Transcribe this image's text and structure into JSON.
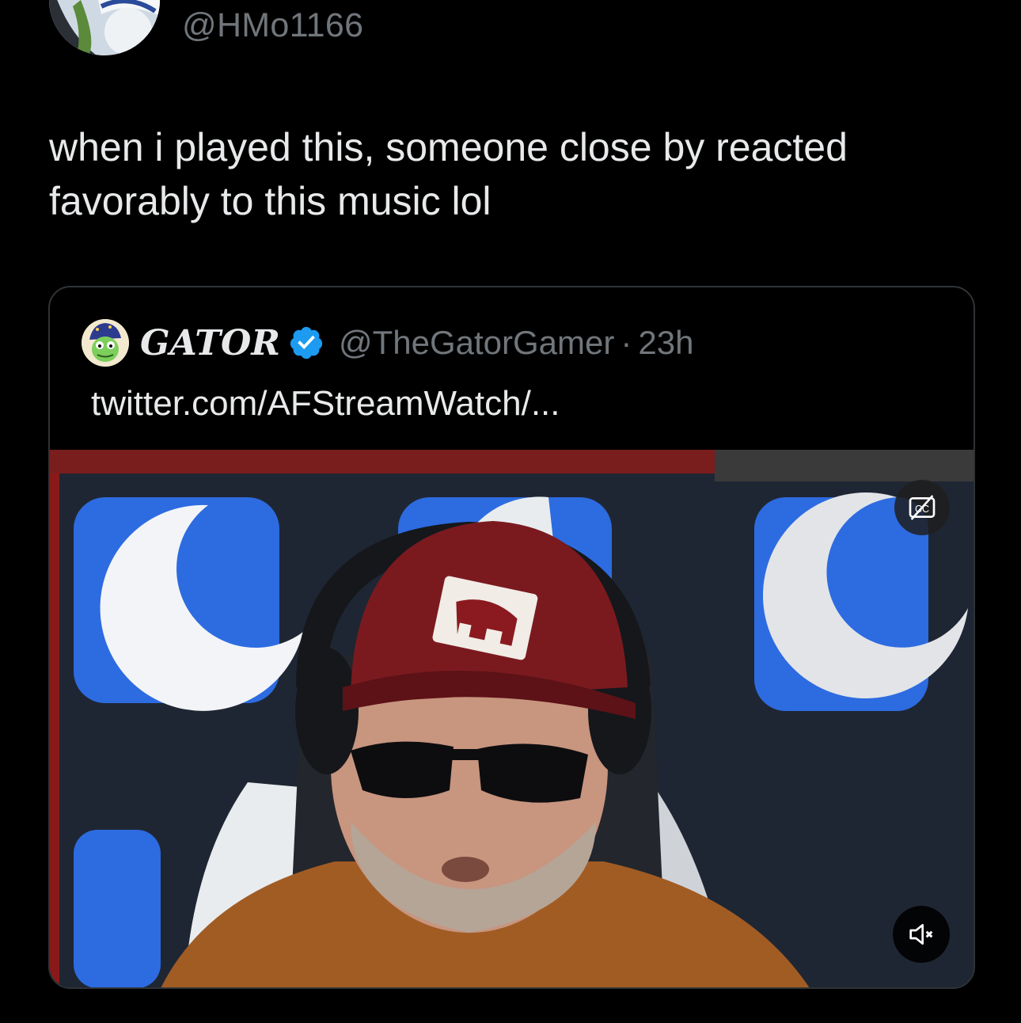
{
  "author": {
    "handle": "@HMo1166",
    "avatar_icon": "michelin-man-avatar"
  },
  "tweet": {
    "lines": [
      "when i played this, someone close by reacted",
      "favorably to this music lol"
    ]
  },
  "quoted_tweet": {
    "display_name": "GATOR",
    "handle": "@TheGatorGamer",
    "separator": "·",
    "time": "23h",
    "link_text": "twitter.com/AFStreamWatch/...",
    "verified": true,
    "avatar_icon": "gator-avatar",
    "video": {
      "cc_icon": "captions-off-icon",
      "mute_icon": "muted-speaker-icon",
      "muted": true
    }
  },
  "colors": {
    "background": "#000000",
    "text_primary": "#e7e9ea",
    "text_secondary": "#71767b",
    "border": "#2f3336",
    "verified_blue": "#1d9bf0"
  }
}
